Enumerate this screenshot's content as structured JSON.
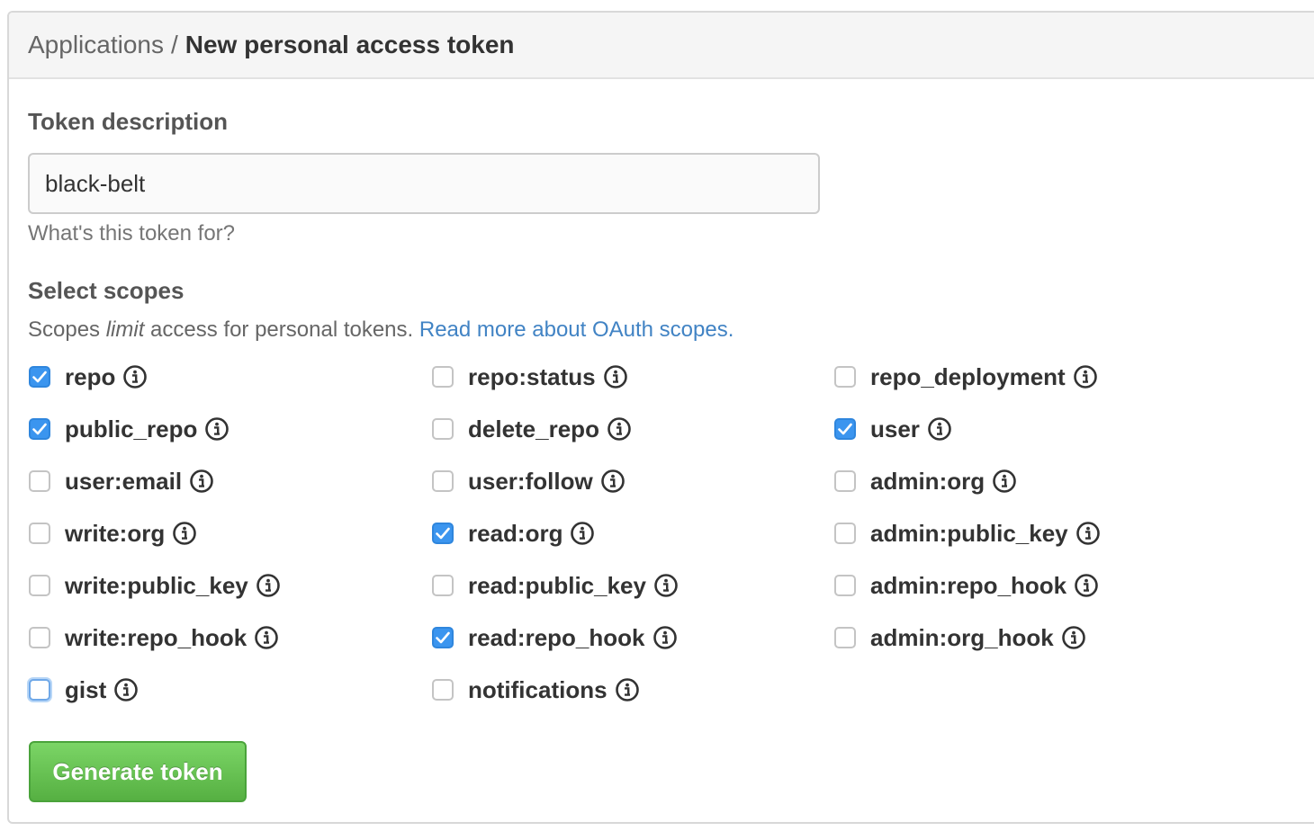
{
  "breadcrumb": {
    "parent": "Applications",
    "separator": "/",
    "current": "New personal access token"
  },
  "token_description": {
    "label": "Token description",
    "value": "black-belt",
    "hint": "What's this token for?"
  },
  "scopes": {
    "heading": "Select scopes",
    "note_prefix": "Scopes ",
    "note_emphasis": "limit",
    "note_suffix": " access for personal tokens. ",
    "note_link": "Read more about OAuth scopes.",
    "items": [
      {
        "label": "repo",
        "checked": true
      },
      {
        "label": "repo:status",
        "checked": false
      },
      {
        "label": "repo_deployment",
        "checked": false
      },
      {
        "label": "public_repo",
        "checked": true
      },
      {
        "label": "delete_repo",
        "checked": false
      },
      {
        "label": "user",
        "checked": true
      },
      {
        "label": "user:email",
        "checked": false
      },
      {
        "label": "user:follow",
        "checked": false
      },
      {
        "label": "admin:org",
        "checked": false
      },
      {
        "label": "write:org",
        "checked": false
      },
      {
        "label": "read:org",
        "checked": true
      },
      {
        "label": "admin:public_key",
        "checked": false
      },
      {
        "label": "write:public_key",
        "checked": false
      },
      {
        "label": "read:public_key",
        "checked": false
      },
      {
        "label": "admin:repo_hook",
        "checked": false
      },
      {
        "label": "write:repo_hook",
        "checked": false
      },
      {
        "label": "read:repo_hook",
        "checked": true
      },
      {
        "label": "admin:org_hook",
        "checked": false
      },
      {
        "label": "gist",
        "checked": false,
        "focused": true
      },
      {
        "label": "notifications",
        "checked": false
      }
    ]
  },
  "actions": {
    "generate_label": "Generate token"
  },
  "colors": {
    "link": "#4183c4",
    "checkbox_checked": "#3b95ef",
    "button_green": "#6cc644"
  }
}
